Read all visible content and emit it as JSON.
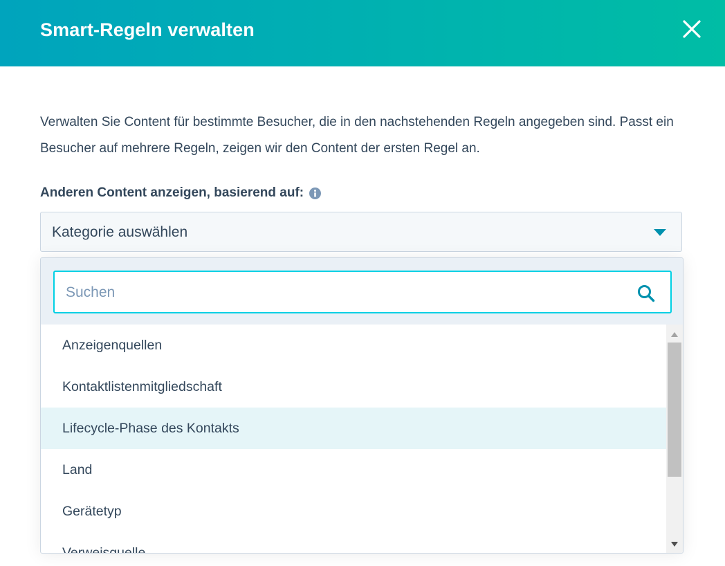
{
  "modal": {
    "title": "Smart-Regeln verwalten",
    "close_icon": "close-icon"
  },
  "description": "Verwalten Sie Content für bestimmte Besucher, die in den nachstehenden Regeln angegeben sind. Passt ein Besucher auf mehrere Regeln, zeigen wir den Content der ersten Regel an.",
  "field": {
    "label": "Anderen Content anzeigen, basierend auf:",
    "info_icon": "info-icon",
    "select_value": "Kategorie auswählen"
  },
  "dropdown": {
    "search_placeholder": "Suchen",
    "search_value": "",
    "options": [
      "Anzeigenquellen",
      "Kontaktlistenmitgliedschaft",
      "Lifecycle-Phase des Kontakts",
      "Land",
      "Gerätetyp",
      "Verweisquelle"
    ],
    "highlighted_index": 2
  },
  "colors": {
    "header_start": "#00a4bd",
    "header_end": "#00bda5",
    "accent": "#0091ae",
    "focus_border": "#00d0e4",
    "text": "#33475b",
    "highlight": "#e5f5f8"
  }
}
